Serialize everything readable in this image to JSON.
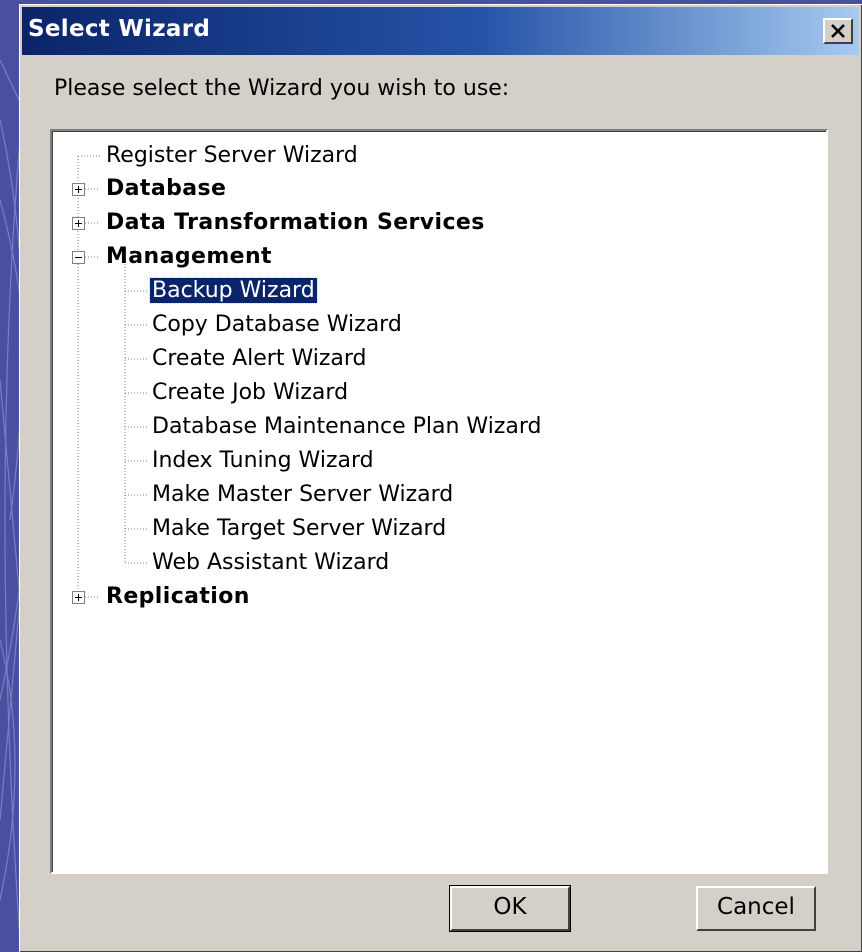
{
  "window": {
    "title": "Select Wizard",
    "close_glyph": "×"
  },
  "prompt": "Please select the Wizard you wish to use:",
  "tree": {
    "items": [
      {
        "label": "Register Server Wizard",
        "bold": false
      },
      {
        "label": "Database",
        "bold": true,
        "state": "collapsed"
      },
      {
        "label": "Data Transformation Services",
        "bold": true,
        "state": "collapsed"
      },
      {
        "label": "Management",
        "bold": true,
        "state": "expanded",
        "children": [
          {
            "label": "Backup Wizard",
            "selected": true
          },
          {
            "label": "Copy Database Wizard"
          },
          {
            "label": "Create Alert Wizard"
          },
          {
            "label": "Create Job Wizard"
          },
          {
            "label": "Database Maintenance Plan Wizard"
          },
          {
            "label": "Index Tuning Wizard"
          },
          {
            "label": "Make Master Server Wizard"
          },
          {
            "label": "Make Target Server Wizard"
          },
          {
            "label": "Web Assistant Wizard"
          }
        ]
      },
      {
        "label": "Replication",
        "bold": true,
        "state": "collapsed"
      }
    ]
  },
  "buttons": {
    "ok": "OK",
    "cancel": "Cancel"
  },
  "colors": {
    "title_bar_start": "#0a246a",
    "title_bar_end": "#a6caf0",
    "selection": "#0a246a",
    "dialog_face": "#d4d0c8",
    "desktop": "#4b4fa0"
  }
}
